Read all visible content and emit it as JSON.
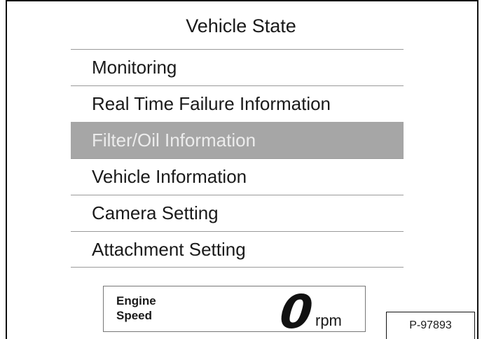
{
  "title": "Vehicle State",
  "menu": {
    "items": [
      {
        "label": "Monitoring",
        "selected": false
      },
      {
        "label": "Real Time Failure Information",
        "selected": false
      },
      {
        "label": "Filter/Oil Information",
        "selected": true
      },
      {
        "label": "Vehicle Information",
        "selected": false
      },
      {
        "label": "Camera Setting",
        "selected": false
      },
      {
        "label": "Attachment Setting",
        "selected": false
      }
    ]
  },
  "engine": {
    "label_line1": "Engine",
    "label_line2": "Speed",
    "value": "0",
    "unit": "rpm"
  },
  "part_number": "P-97893",
  "colors": {
    "selected_bg": "#a6a6a6",
    "selected_text": "#ececec",
    "divider": "#9a9a9a"
  }
}
